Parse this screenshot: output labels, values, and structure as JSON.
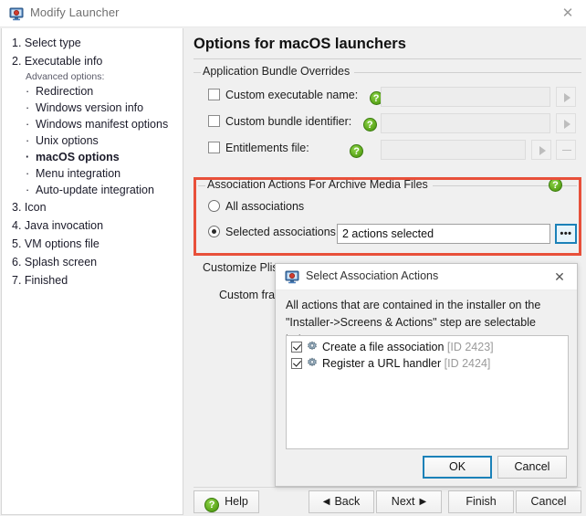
{
  "window": {
    "title": "Modify Launcher",
    "icon": "monitor-icon",
    "close_label": "✕"
  },
  "sidebar": {
    "items": [
      {
        "label": "1. Select type",
        "type": "step"
      },
      {
        "label": "2. Executable info",
        "type": "step"
      },
      {
        "label": "Advanced options:",
        "type": "subtitle"
      },
      {
        "label": "Redirection",
        "type": "sub"
      },
      {
        "label": "Windows version info",
        "type": "sub"
      },
      {
        "label": "Windows manifest options",
        "type": "sub"
      },
      {
        "label": "Unix options",
        "type": "sub"
      },
      {
        "label": "macOS options",
        "type": "sub",
        "current": true
      },
      {
        "label": "Menu integration",
        "type": "sub"
      },
      {
        "label": "Auto-update integration",
        "type": "sub"
      },
      {
        "label": "3. Icon",
        "type": "step"
      },
      {
        "label": "4. Java invocation",
        "type": "step"
      },
      {
        "label": "5. VM options file",
        "type": "step"
      },
      {
        "label": "6. Splash screen",
        "type": "step"
      },
      {
        "label": "7. Finished",
        "type": "step"
      }
    ],
    "bullet": "·"
  },
  "main": {
    "page_title": "Options for macOS launchers",
    "bundle_group": {
      "label": "Application Bundle Overrides",
      "rows": [
        {
          "label": "Custom executable name:",
          "checked": false,
          "value": "",
          "help": "?"
        },
        {
          "label": "Custom bundle identifier:",
          "checked": false,
          "value": "",
          "help": "?"
        },
        {
          "label": "Entitlements file:",
          "checked": false,
          "value": "",
          "help": "?"
        }
      ]
    },
    "association_group": {
      "label": "Association Actions For Archive Media Files",
      "help": "?",
      "radio_all": "All associations",
      "radio_selected": "Selected associations:",
      "selected_mode": "selected",
      "selected_value": "2 actions selected",
      "browse_label": "•••",
      "highlight_color": "#e8503a"
    },
    "plist_group": {
      "label": "Customize Plist F",
      "fragment_label": "Custom fragme"
    }
  },
  "buttons": {
    "help": "Help",
    "back": "Back",
    "next": "Next",
    "finish": "Finish",
    "cancel": "Cancel"
  },
  "dialog": {
    "title": "Select Association Actions",
    "icon": "monitor-icon",
    "close_label": "✕",
    "description": "All actions that are contained in the installer on the \"Installer->Screens & Actions\" step are selectable below.",
    "items": [
      {
        "label": "Create a file association",
        "id": "[ID 2423]",
        "checked": true,
        "icon": "gear-icon"
      },
      {
        "label": "Register a URL handler",
        "id": "[ID 2424]",
        "checked": true,
        "icon": "gear-icon"
      }
    ],
    "ok": "OK",
    "cancel": "Cancel"
  }
}
